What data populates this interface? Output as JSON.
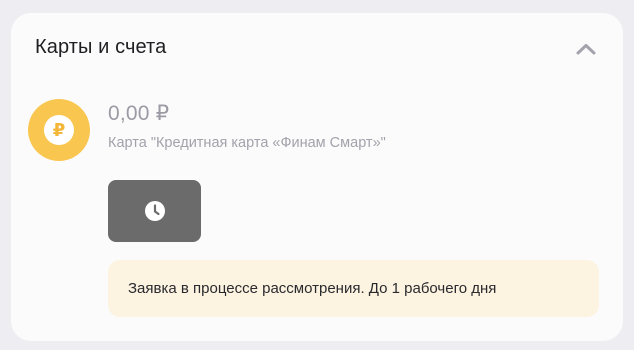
{
  "section": {
    "title": "Карты и счета",
    "collapse_icon": "chevron-up-icon"
  },
  "account": {
    "icon": "ruble-coin-icon",
    "currency_symbol": "₽",
    "balance": "0,00 ₽",
    "name": "Карта \"Кредитная карта «Финам Смарт»\"",
    "status_icon": "clock-icon"
  },
  "notice": {
    "text": "Заявка в процессе рассмотрения. До 1 рабочего дня"
  },
  "colors": {
    "background": "#eeedf1",
    "card": "#fbfbfb",
    "accent_gold": "#f9c64f",
    "pending_tile": "#6b6b6b",
    "notice_bg": "#fcf3e1"
  }
}
